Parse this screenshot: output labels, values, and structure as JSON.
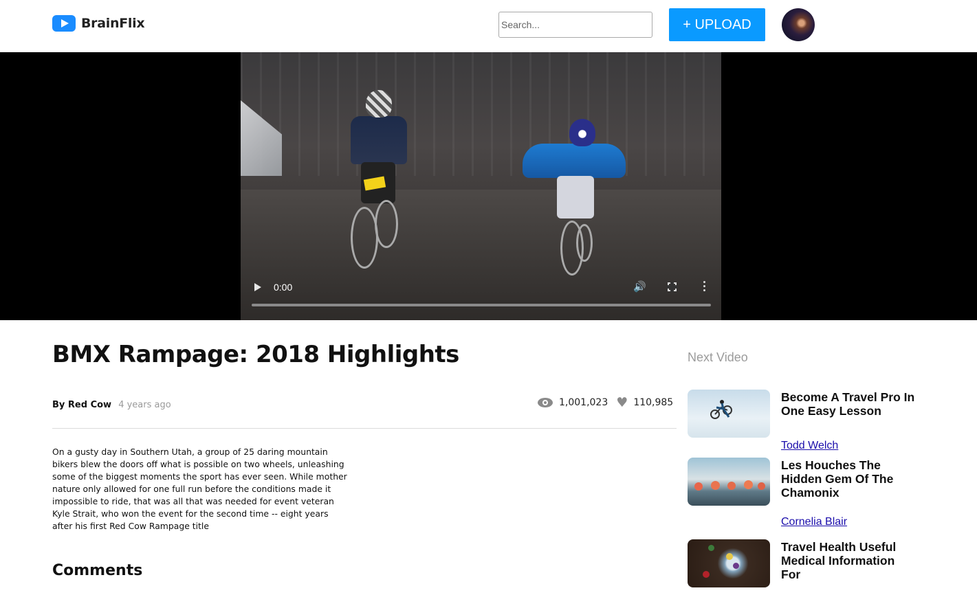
{
  "header": {
    "brand": "BrainFlix",
    "search_placeholder": "Search...",
    "upload_label": "+ UPLOAD"
  },
  "player": {
    "current_time": "0:00"
  },
  "video": {
    "title": "BMX Rampage: 2018 Highlights",
    "author": "By Red Cow",
    "posted": "4 years ago",
    "views": "1,001,023",
    "likes": "110,985",
    "description": "On a gusty day in Southern Utah, a group of 25 daring mountain bikers blew the doors off what is possible on two wheels, unleashing some of the biggest moments the sport has ever seen. While mother nature only allowed for one full run before the conditions made it impossible to ride, that was all that was needed for event veteran Kyle Strait, who won the event for the second time -- eight years after his first Red Cow Rampage title"
  },
  "comments": {
    "heading": "Comments"
  },
  "sidebar": {
    "heading": "Next Video",
    "items": [
      {
        "title": "Become A Travel Pro In One Easy Lesson",
        "author": "Todd Welch"
      },
      {
        "title": "Les Houches The Hidden Gem Of The Chamonix",
        "author": "Cornelia Blair"
      },
      {
        "title": "Travel Health Useful Medical Information For",
        "author": ""
      }
    ]
  },
  "colors": {
    "accent": "#0a9aff",
    "logo": "#1a8cff",
    "muted": "#9b9b9b",
    "link": "#1a0dab"
  },
  "icons": {
    "logo": "play-logo-icon",
    "views": "eye-icon",
    "likes": "heart-icon",
    "play": "play-icon",
    "volume": "volume-icon",
    "fullscreen": "fullscreen-icon",
    "more": "more-options-icon"
  }
}
